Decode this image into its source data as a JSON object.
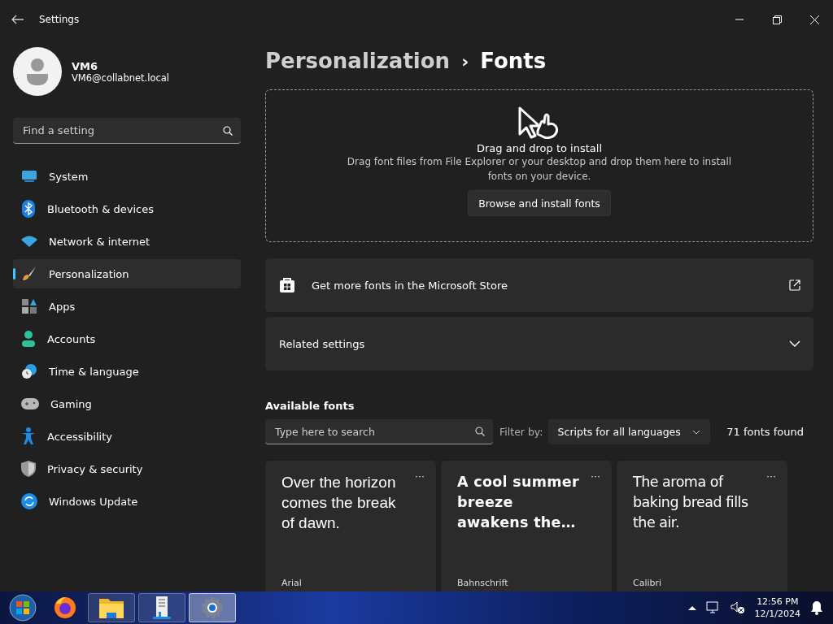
{
  "window": {
    "title": "Settings"
  },
  "profile": {
    "name": "VM6",
    "email": "VM6@collabnet.local"
  },
  "search": {
    "placeholder": "Find a setting"
  },
  "nav": [
    {
      "label": "System",
      "selected": false
    },
    {
      "label": "Bluetooth & devices",
      "selected": false
    },
    {
      "label": "Network & internet",
      "selected": false
    },
    {
      "label": "Personalization",
      "selected": true
    },
    {
      "label": "Apps",
      "selected": false
    },
    {
      "label": "Accounts",
      "selected": false
    },
    {
      "label": "Time & language",
      "selected": false
    },
    {
      "label": "Gaming",
      "selected": false
    },
    {
      "label": "Accessibility",
      "selected": false
    },
    {
      "label": "Privacy & security",
      "selected": false
    },
    {
      "label": "Windows Update",
      "selected": false
    }
  ],
  "breadcrumb": {
    "parent": "Personalization",
    "separator": "›",
    "current": "Fonts"
  },
  "dropzone": {
    "title": "Drag and drop to install",
    "description": "Drag font files from File Explorer or your desktop and drop them here to install fonts on your device.",
    "button": "Browse and install fonts"
  },
  "store_link": {
    "label": "Get more fonts in the Microsoft Store"
  },
  "related": {
    "label": "Related settings",
    "expanded": false
  },
  "available": {
    "heading": "Available fonts",
    "search_placeholder": "Type here to search",
    "filter_label": "Filter by:",
    "filter_value": "Scripts for all languages",
    "count": "71 fonts found"
  },
  "fonts": [
    {
      "sample": "Over the horizon comes the break of dawn.",
      "name": "Arial",
      "more": "···"
    },
    {
      "sample": "A cool summer breeze awakens the…",
      "name": "Bahnschrift",
      "more": "···"
    },
    {
      "sample": "The aroma of baking bread fills the air.",
      "name": "Calibri",
      "more": "···"
    }
  ],
  "taskbar": {
    "time": "12:56 PM",
    "date": "12/1/2024",
    "apps": [
      {
        "selected": false
      },
      {
        "selected": false
      },
      {
        "selected": true
      }
    ]
  }
}
